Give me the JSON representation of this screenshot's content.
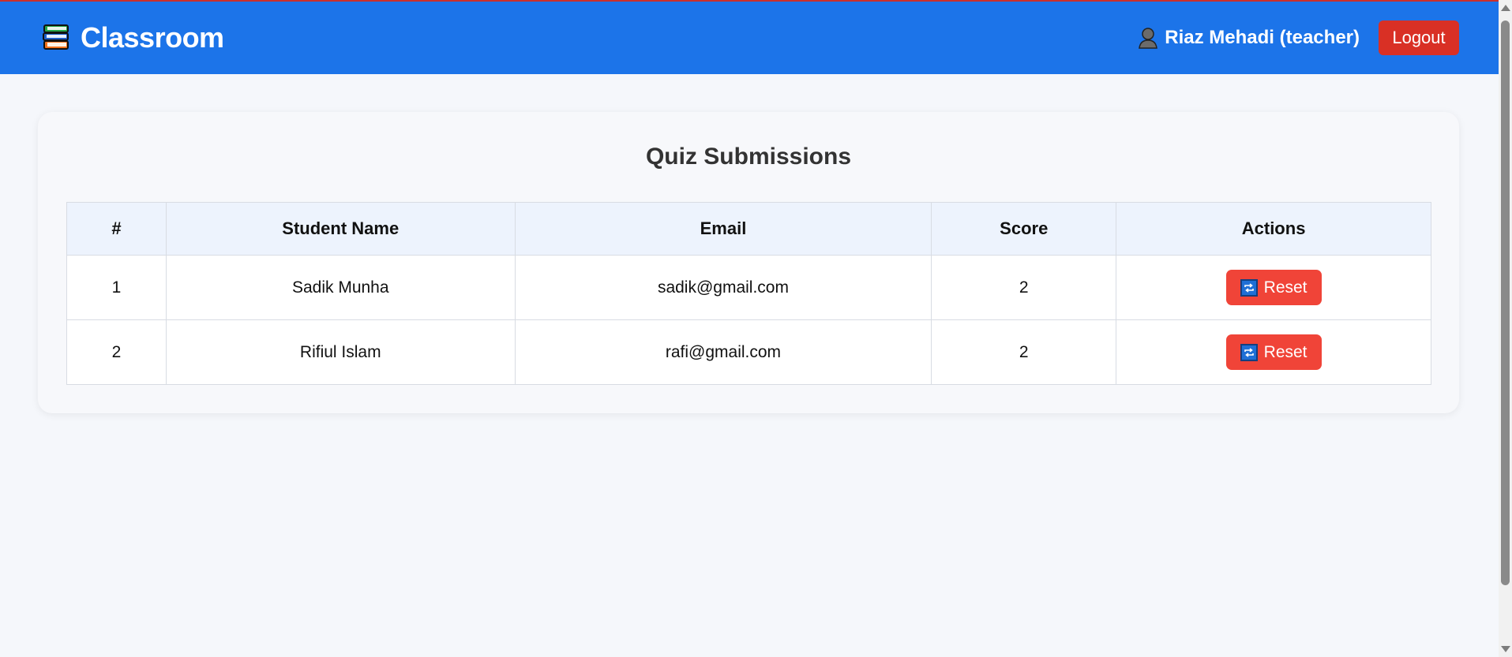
{
  "header": {
    "brand_icon": "books-icon",
    "brand_title": "Classroom",
    "user_icon": "user-icon",
    "user_name": "Riaz Mehadi (teacher)",
    "logout_label": "Logout",
    "bg_color": "#1c74e9",
    "logout_color": "#d93025"
  },
  "main": {
    "title": "Quiz Submissions",
    "table": {
      "headers": [
        "#",
        "Student Name",
        "Email",
        "Score",
        "Actions"
      ],
      "rows": [
        {
          "num": "1",
          "name": "Sadik Munha",
          "email": "sadik@gmail.com",
          "score": "2",
          "action_label": "Reset",
          "action_icon": "repeat-icon"
        },
        {
          "num": "2",
          "name": "Rifiul Islam",
          "email": "rafi@gmail.com",
          "score": "2",
          "action_label": "Reset",
          "action_icon": "repeat-icon"
        }
      ]
    },
    "reset_color": "#f04438"
  }
}
